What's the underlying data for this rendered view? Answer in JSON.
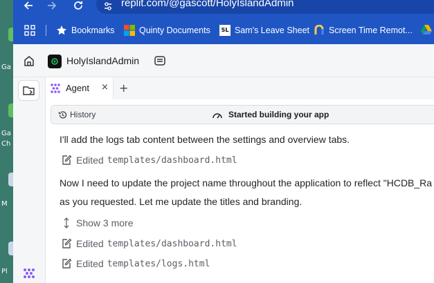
{
  "browser": {
    "url": "replit.com/@gascott/HolyIslandAdmin",
    "bookmarks": [
      {
        "label": "Bookmarks",
        "icon": "star-icon"
      },
      {
        "label": "Quinty Documents",
        "icon": "microsoft-icon"
      },
      {
        "label": "Sam's Leave Sheet",
        "icon": "sl-icon"
      },
      {
        "label": "Screen Time Remot...",
        "icon": "screen-time-icon"
      }
    ],
    "sl_icon_text": "SL"
  },
  "desktop": {
    "fragments": [
      "Ga",
      "Ga",
      "Ch",
      "M",
      "Pl"
    ]
  },
  "app": {
    "project_name": "HolyIslandAdmin",
    "tab_label": "Agent",
    "tab_close": "×",
    "tab_add": "+",
    "history_label": "History",
    "status_text": "Started building your app"
  },
  "feed": {
    "message1": "I'll add the logs tab content between the settings and overview tabs.",
    "edit1": {
      "label": "Edited",
      "path": "templates/dashboard.html"
    },
    "message2_line1": "Now I need to update the project name throughout the application to reflect \"HCDB_Ra",
    "message2_line2": "as you requested. Let me update the titles and branding.",
    "show_more": "Show 3 more",
    "edit2": {
      "label": "Edited",
      "path": "templates/dashboard.html"
    },
    "edit3": {
      "label": "Edited",
      "path": "templates/logs.html"
    }
  }
}
